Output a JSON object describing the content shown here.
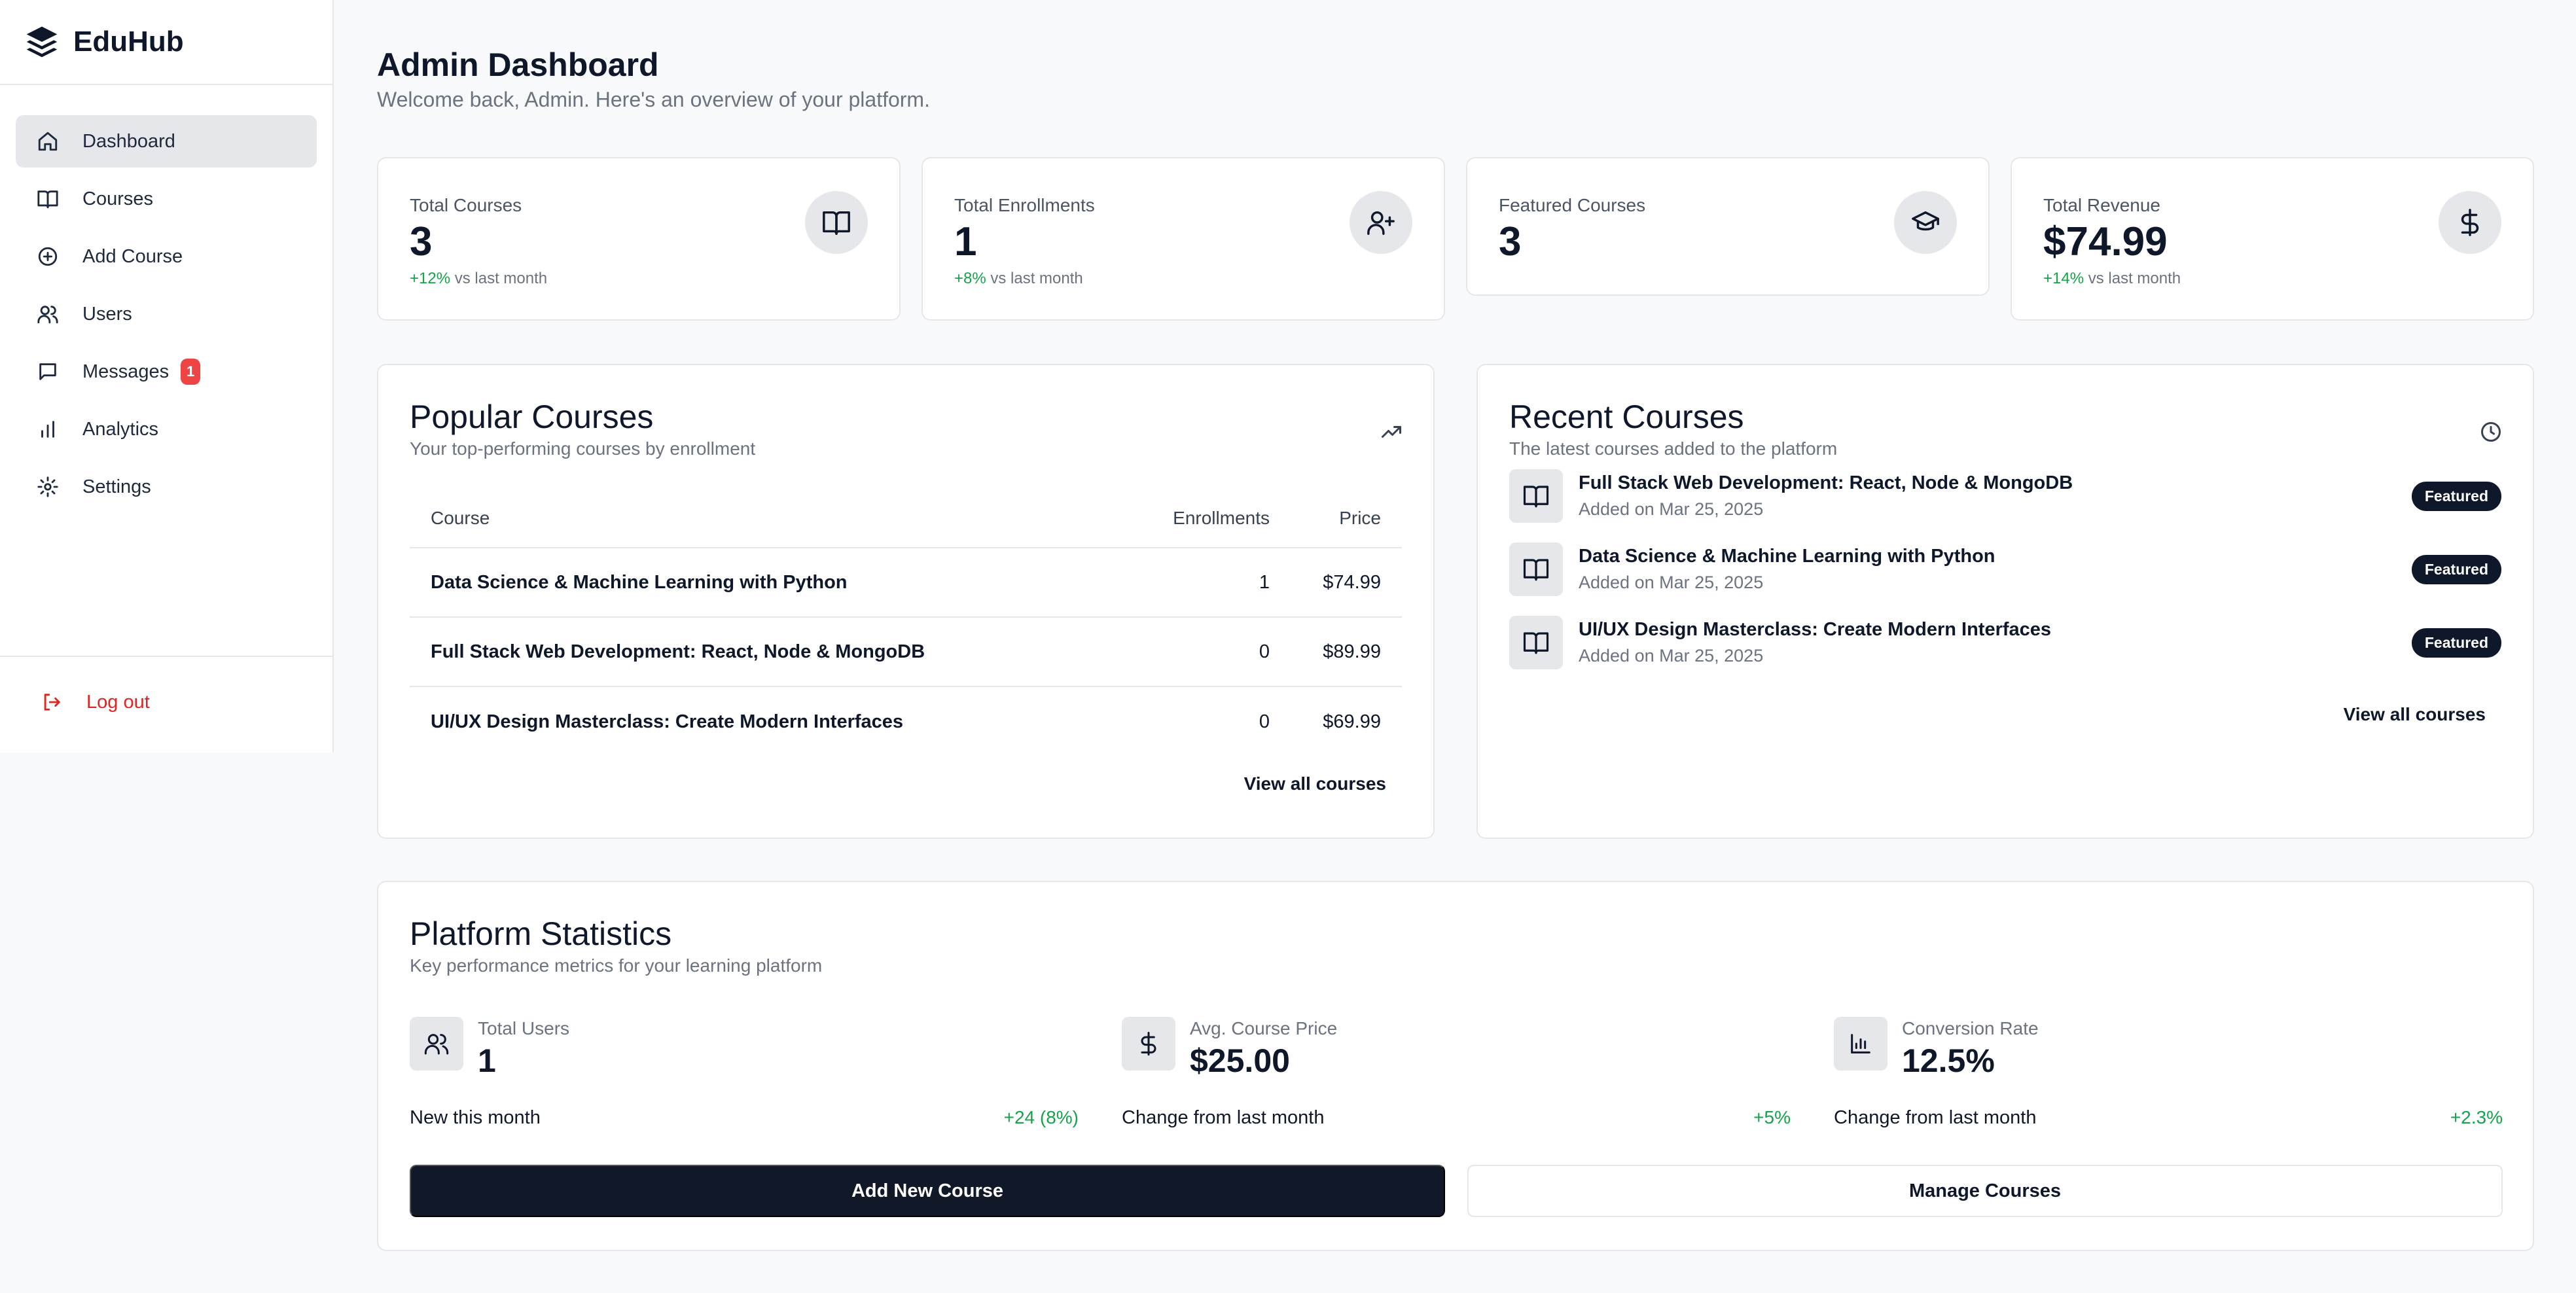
{
  "app": {
    "name": "EduHub"
  },
  "sidebar": {
    "items": [
      {
        "label": "Dashboard",
        "icon": "home-icon",
        "active": true
      },
      {
        "label": "Courses",
        "icon": "book-icon"
      },
      {
        "label": "Add Course",
        "icon": "plus-circle-icon"
      },
      {
        "label": "Users",
        "icon": "users-icon"
      },
      {
        "label": "Messages",
        "icon": "message-icon",
        "badge": "1"
      },
      {
        "label": "Analytics",
        "icon": "bar-chart-icon"
      },
      {
        "label": "Settings",
        "icon": "gear-icon"
      }
    ],
    "logout_label": "Log out"
  },
  "header": {
    "title": "Admin Dashboard",
    "subtitle": "Welcome back, Admin. Here's an overview of your platform."
  },
  "stats": [
    {
      "label": "Total Courses",
      "value": "3",
      "change": "+12%",
      "change_suffix": "vs last month",
      "icon": "book-icon"
    },
    {
      "label": "Total Enrollments",
      "value": "1",
      "change": "+8%",
      "change_suffix": "vs last month",
      "icon": "user-plus-icon"
    },
    {
      "label": "Featured Courses",
      "value": "3",
      "icon": "graduation-cap-icon"
    },
    {
      "label": "Total Revenue",
      "value": "$74.99",
      "change": "+14%",
      "change_suffix": "vs last month",
      "icon": "dollar-icon"
    }
  ],
  "popular": {
    "title": "Popular Courses",
    "subtitle": "Your top-performing courses by enrollment",
    "columns": [
      "Course",
      "Enrollments",
      "Price"
    ],
    "rows": [
      {
        "course": "Data Science & Machine Learning with Python",
        "enrollments": "1",
        "price": "$74.99"
      },
      {
        "course": "Full Stack Web Development: React, Node & MongoDB",
        "enrollments": "0",
        "price": "$89.99"
      },
      {
        "course": "UI/UX Design Masterclass: Create Modern Interfaces",
        "enrollments": "0",
        "price": "$69.99"
      }
    ],
    "view_all": "View all courses"
  },
  "recent": {
    "title": "Recent Courses",
    "subtitle": "The latest courses added to the platform",
    "items": [
      {
        "title": "Full Stack Web Development: React, Node & MongoDB",
        "date": "Added on Mar 25, 2025",
        "badge": "Featured"
      },
      {
        "title": "Data Science & Machine Learning with Python",
        "date": "Added on Mar 25, 2025",
        "badge": "Featured"
      },
      {
        "title": "UI/UX Design Masterclass: Create Modern Interfaces",
        "date": "Added on Mar 25, 2025",
        "badge": "Featured"
      }
    ],
    "view_all": "View all courses"
  },
  "platform": {
    "title": "Platform Statistics",
    "subtitle": "Key performance metrics for your learning platform",
    "items": [
      {
        "label": "Total Users",
        "value": "1",
        "note": "New this month",
        "delta": "+24 (8%)",
        "icon": "users-icon"
      },
      {
        "label": "Avg. Course Price",
        "value": "$25.00",
        "note": "Change from last month",
        "delta": "+5%",
        "icon": "dollar-icon"
      },
      {
        "label": "Conversion Rate",
        "value": "12.5%",
        "note": "Change from last month",
        "delta": "+2.3%",
        "icon": "bar-chart-icon"
      }
    ],
    "primary_button": "Add New Course",
    "secondary_button": "Manage Courses"
  },
  "colors": {
    "accent": "#111827",
    "positive": "#16a34a",
    "danger": "#dc2626",
    "badge": "#ef4444"
  }
}
